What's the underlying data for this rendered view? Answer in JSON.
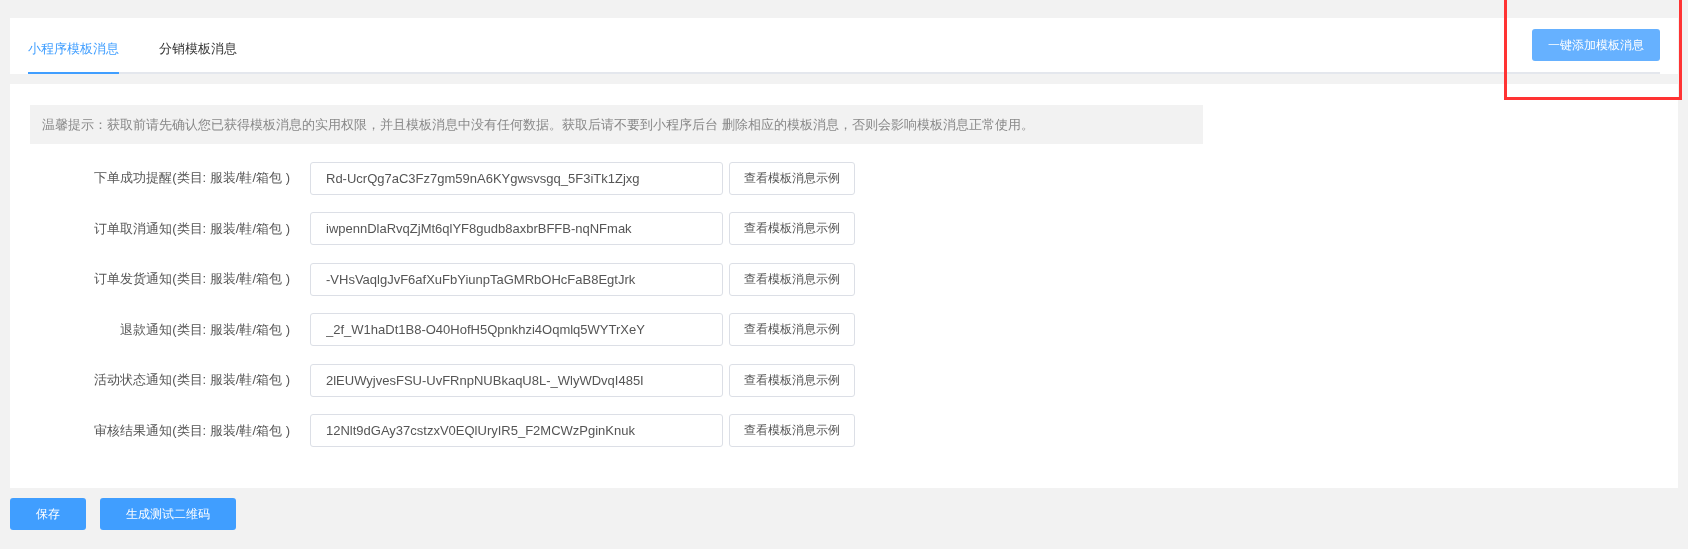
{
  "tabs": [
    {
      "label": "小程序模板消息",
      "selected": true
    },
    {
      "label": "分销模板消息",
      "selected": false
    }
  ],
  "add_button": "一键添加模板消息",
  "highlight": {
    "color": "#ff3333"
  },
  "notice": "温馨提示：获取前请先确认您已获得模板消息的实用权限，并且模板消息中没有任何数据。获取后请不要到小程序后台 删除相应的模板消息，否则会影响模板消息正常使用。",
  "templates": [
    {
      "label": "下单成功提醒(类目: 服装/鞋/箱包 )",
      "value": "Rd-UcrQg7aC3Fz7gm59nA6KYgwsvsgq_5F3iTk1Zjxg",
      "button": "查看模板消息示例"
    },
    {
      "label": "订单取消通知(类目: 服装/鞋/箱包 )",
      "value": "iwpennDlaRvqZjMt6qlYF8gudb8axbrBFFB-nqNFmak",
      "button": "查看模板消息示例"
    },
    {
      "label": "订单发货通知(类目: 服装/鞋/箱包 )",
      "value": "-VHsVaqlgJvF6afXuFbYiunpTaGMRbOHcFaB8EgtJrk",
      "button": "查看模板消息示例"
    },
    {
      "label": "退款通知(类目: 服装/鞋/箱包 )",
      "value": "_2f_W1haDt1B8-O40HofH5Qpnkhzi4Oqmlq5WYTrXeY",
      "button": "查看模板消息示例"
    },
    {
      "label": "活动状态通知(类目: 服装/鞋/箱包 )",
      "value": "2lEUWyjvesFSU-UvFRnpNUBkaqU8L-_WlyWDvqI485I",
      "button": "查看模板消息示例"
    },
    {
      "label": "审核结果通知(类目: 服装/鞋/箱包 )",
      "value": "12Nlt9dGAy37cstzxV0EQlUryIR5_F2MCWzPginKnuk",
      "button": "查看模板消息示例"
    }
  ],
  "footer_buttons": [
    "保存",
    "生成测试二维码"
  ]
}
